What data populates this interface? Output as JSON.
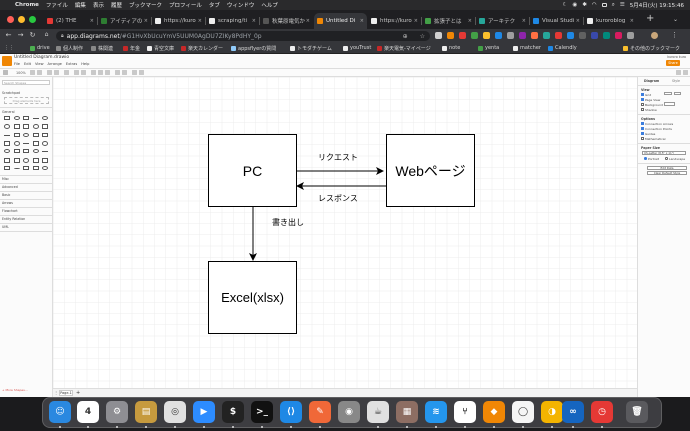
{
  "menubar": {
    "app_name": "Chrome",
    "items": [
      "ファイル",
      "編集",
      "表示",
      "履歴",
      "ブックマーク",
      "プロフィール",
      "タブ",
      "ウィンドウ",
      "ヘルプ"
    ],
    "clock": "5月4日(火) 19:15:46"
  },
  "tabs": [
    {
      "label": "(2) THE",
      "color": "#e53935"
    },
    {
      "label": "アイディアの",
      "color": "#2e7d32"
    },
    {
      "label": "https://kuro",
      "color": "#eeeeee"
    },
    {
      "label": "scraping/ti",
      "color": "#eeeeee"
    },
    {
      "label": "秋葉原電気か",
      "color": "#555555"
    },
    {
      "label": "Untitled Di",
      "color": "#f08705",
      "active": true
    },
    {
      "label": "https://kuro",
      "color": "#eeeeee"
    },
    {
      "label": "拡張子とは",
      "color": "#43a047"
    },
    {
      "label": "アーキテク",
      "color": "#26a69a"
    },
    {
      "label": "Visual Studi",
      "color": "#1e88e5"
    },
    {
      "label": "kuroroblog",
      "color": "#eeeeee"
    }
  ],
  "address": {
    "host": "app.diagrams.net",
    "path": "/#G1HvXbUcuYmV5UUM0AgDU7ZIKy8PdHY_0p"
  },
  "bookmarks": [
    {
      "label": "drive",
      "color": "#4caf50"
    },
    {
      "label": "個人制作",
      "color": "#888888"
    },
    {
      "label": "株関連",
      "color": "#888888"
    },
    {
      "label": "年金",
      "color": "#c62828"
    },
    {
      "label": "青空文庫",
      "color": "#eeeeee"
    },
    {
      "label": "楽天カレンダー",
      "color": "#c62828"
    },
    {
      "label": "appsflyerの質問",
      "color": "#90caf9"
    },
    {
      "label": "トモダチゲーム",
      "color": "#eeeeee"
    },
    {
      "label": "youTrust",
      "color": "#eeeeee"
    },
    {
      "label": "楽天電気-マイページ",
      "color": "#c62828"
    },
    {
      "label": "note",
      "color": "#eeeeee"
    },
    {
      "label": "yenta",
      "color": "#43a047"
    },
    {
      "label": "matcher",
      "color": "#eeeeee"
    },
    {
      "label": "Calendly",
      "color": "#1e88e5"
    },
    {
      "label": "その他のブックマーク",
      "color": "#fbc02d"
    }
  ],
  "drawio": {
    "doc_title": "Untitled Diagram.drawio",
    "menus": [
      "File",
      "Edit",
      "View",
      "Arrange",
      "Extras",
      "Help"
    ],
    "user_name": "kuroro kuro",
    "share_label": "Share",
    "zoom": "100%",
    "search_placeholder": "Search Shapes",
    "sections": {
      "scratchpad": "Scratchpad",
      "general": "General",
      "misc": "Misc",
      "advanced": "Advanced",
      "basic": "Basic",
      "arrows": "Arrows",
      "flowchart": "Flowchart",
      "entity": "Entity Relation",
      "uml": "UML"
    },
    "scratchpad_hint": "Drag elements here",
    "more_shapes": "+ More Shapes...",
    "page_tab": "Page-1",
    "right_panel": {
      "tabs": [
        "Diagram",
        "Style"
      ],
      "view_heading": "View",
      "checks": [
        "Grid",
        "Page View",
        "Background",
        "Shadow"
      ],
      "options_heading": "Options",
      "options": [
        "Connection Arrows",
        "Connection Points",
        "Guides",
        "Mathematical"
      ],
      "paper_heading": "Paper Size",
      "paper_value": "US-Letter (8.5\" x 11\")",
      "orientation": [
        "Portrait",
        "Landscape"
      ],
      "btn_edit": "Edit Data",
      "btn_clear": "Clear Default Style"
    }
  },
  "diagram": {
    "node_pc": "PC",
    "node_web": "Webページ",
    "node_excel": "Excel(xlsx)",
    "label_request": "リクエスト",
    "label_response": "レスポンス",
    "label_export": "書き出し"
  },
  "dock": [
    {
      "name": "finder-icon",
      "color": "#2a88e0",
      "glyph": "☺"
    },
    {
      "name": "calendar-icon",
      "color": "#ffffff",
      "glyph": "4"
    },
    {
      "name": "system-preferences-icon",
      "color": "#8e8e93",
      "glyph": "⚙"
    },
    {
      "name": "notes-folder-icon",
      "color": "#c69a3e",
      "glyph": "▤"
    },
    {
      "name": "chrome-icon",
      "color": "#e0e0e0",
      "glyph": "◎"
    },
    {
      "name": "zoom-icon",
      "color": "#2d8cff",
      "glyph": "▶"
    },
    {
      "name": "iterm-icon",
      "color": "#222222",
      "glyph": "$"
    },
    {
      "name": "terminal-icon",
      "color": "#111111",
      "glyph": ">_"
    },
    {
      "name": "vscode-icon",
      "color": "#1e88e5",
      "glyph": "⟨⟩"
    },
    {
      "name": "compass-icon",
      "color": "#f06838",
      "glyph": "✎"
    },
    {
      "name": "preview-icon",
      "color": "#888888",
      "glyph": "◉"
    },
    {
      "name": "sequel-icon",
      "color": "#e0e0e0",
      "glyph": "☕"
    },
    {
      "name": "archive-icon",
      "color": "#8d6e63",
      "glyph": "▦"
    },
    {
      "name": "docker-icon",
      "color": "#2496ed",
      "glyph": "≋"
    },
    {
      "name": "sourcetree-icon",
      "color": "#ffffff",
      "glyph": "⑂"
    },
    {
      "name": "drawio-icon",
      "color": "#f08705",
      "glyph": "◆"
    },
    {
      "name": "tableplus-icon",
      "color": "#f5f5f5",
      "glyph": "◯"
    },
    {
      "name": "photos-icon",
      "color": "#f4b400",
      "glyph": "◑"
    },
    {
      "name": "infinity-icon",
      "color": "#1565c0",
      "glyph": "∞"
    },
    {
      "name": "clock-app-icon",
      "color": "#e53935",
      "glyph": "◷"
    },
    {
      "name": "trash-icon",
      "color": "#5a5a5e",
      "glyph": "🗑"
    }
  ]
}
